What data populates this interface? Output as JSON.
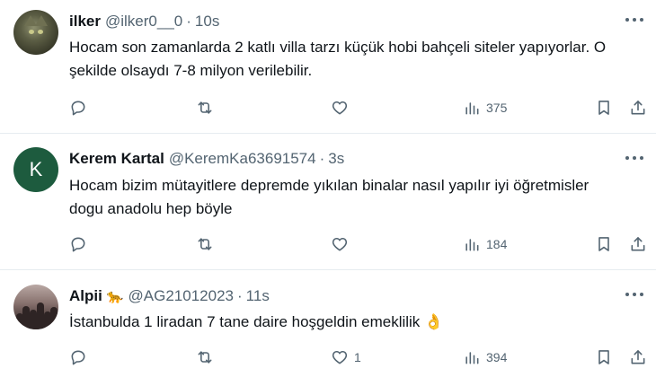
{
  "tweets": [
    {
      "name": "ilker",
      "handle": "@ilker0__0",
      "time": "10s",
      "text": "Hocam son zamanlarda 2 katlı villa tarzı küçük hobi bahçeli siteler yapıyorlar. O şekilde olsaydı 7-8 milyon verilebilir.",
      "avatar": "cat-photo",
      "likes": "",
      "views": "375"
    },
    {
      "name": "Kerem Kartal",
      "handle": "@KeremKa63691574",
      "time": "3s",
      "text": "Hocam bizim mütayitlere depremde yıkılan binalar nasıl yapılır iyi öğretmisler dogu anadolu hep böyle",
      "avatar_letter": "K",
      "avatar_color": "#1d5b3e",
      "likes": "",
      "views": "184"
    },
    {
      "name": "Alpii",
      "name_emoji": "🐆",
      "handle": "@AG21012023",
      "time": "11s",
      "text": "İstanbulda 1 liradan 7 tane daire hoşgeldin emeklilik 👌",
      "avatar": "crowd-photo",
      "likes": "1",
      "views": "394"
    }
  ],
  "separator": "·",
  "icons": {
    "reply": "reply-icon",
    "retweet": "retweet-icon",
    "like": "heart-icon",
    "views": "views-icon",
    "bookmark": "bookmark-icon",
    "share": "share-icon",
    "more": "more-icon"
  },
  "colors": {
    "text": "#0f1419",
    "secondary": "#536471",
    "divider": "#e6ecf0"
  }
}
